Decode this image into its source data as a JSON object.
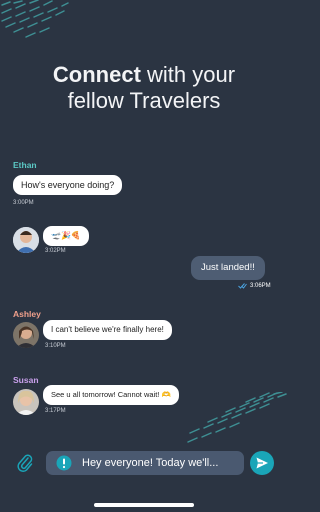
{
  "header": {
    "title_bold": "Connect",
    "title_rest": " with your",
    "title_line2": "fellow Travelers"
  },
  "messages": [
    {
      "sender": "Ethan",
      "text": "How's everyone doing?",
      "time": "3:00PM",
      "sender_color": "#5bc8c4"
    },
    {
      "sender": "",
      "text": "🛫🎉🍕",
      "time": "3:02PM"
    },
    {
      "sender": "",
      "text": "Just landed!!",
      "time": "3:06PM",
      "mine": true
    },
    {
      "sender": "Ashley",
      "text": "I can't believe we're finally here!",
      "time": "3:10PM",
      "sender_color": "#f0a08c"
    },
    {
      "sender": "Susan",
      "text": "See u all tomorrow! Cannot wait! 🫶",
      "time": "3:17PM",
      "sender_color": "#c9a0ec"
    }
  ],
  "composer": {
    "value": "Hey everyone! Today we'll...",
    "icons": [
      "paperclip-icon",
      "alert-icon",
      "send-icon"
    ]
  },
  "colors": {
    "background": "#2b3442",
    "accent": "#1aa5b8",
    "my_bubble": "#4e5d73",
    "input_bg": "#4a5970"
  }
}
